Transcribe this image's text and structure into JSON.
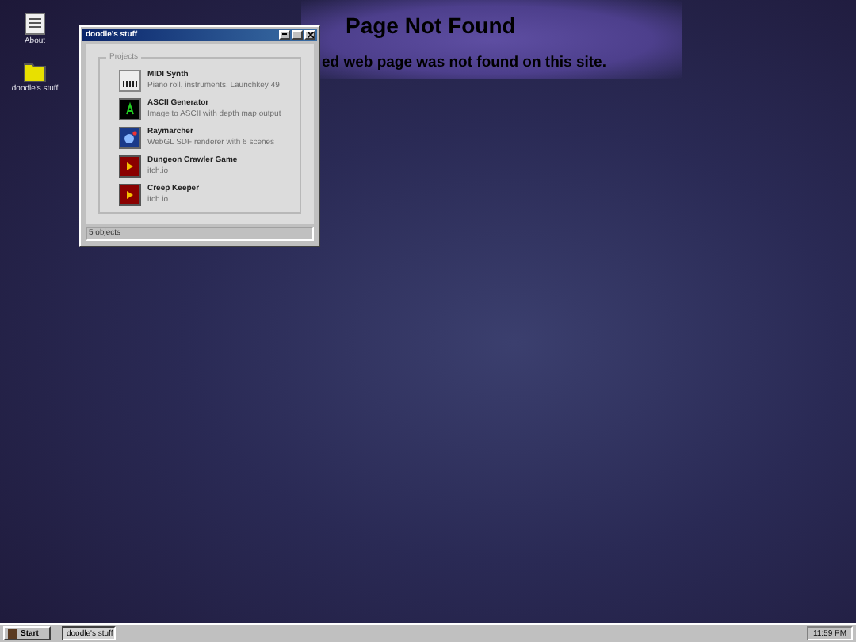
{
  "desktop": {
    "heading": "Page Not Found",
    "message": "ed web page was not found on this site.",
    "icons": [
      {
        "kind": "document",
        "label": "About"
      },
      {
        "kind": "folder",
        "label": "doodle's stuff"
      }
    ]
  },
  "window": {
    "title": "doodle's stuff",
    "group": "Projects",
    "items": [
      {
        "kind": "piano",
        "name": "MIDI Synth",
        "description": "Piano roll, instruments, Launchkey 49"
      },
      {
        "kind": "terminal",
        "name": "ASCII Generator",
        "description": "Image to ASCII with depth map output"
      },
      {
        "kind": "orb",
        "name": "Raymarcher",
        "description": "WebGL SDF renderer with 6 scenes"
      },
      {
        "kind": "play",
        "name": "Dungeon Crawler Game",
        "description": "itch.io"
      },
      {
        "kind": "play",
        "name": "Creep Keeper",
        "description": "itch.io"
      }
    ],
    "status": "5 objects"
  },
  "taskbar": {
    "start": "Start",
    "tasks": [
      "doodle's stuff"
    ],
    "clock": "11:59 PM"
  }
}
